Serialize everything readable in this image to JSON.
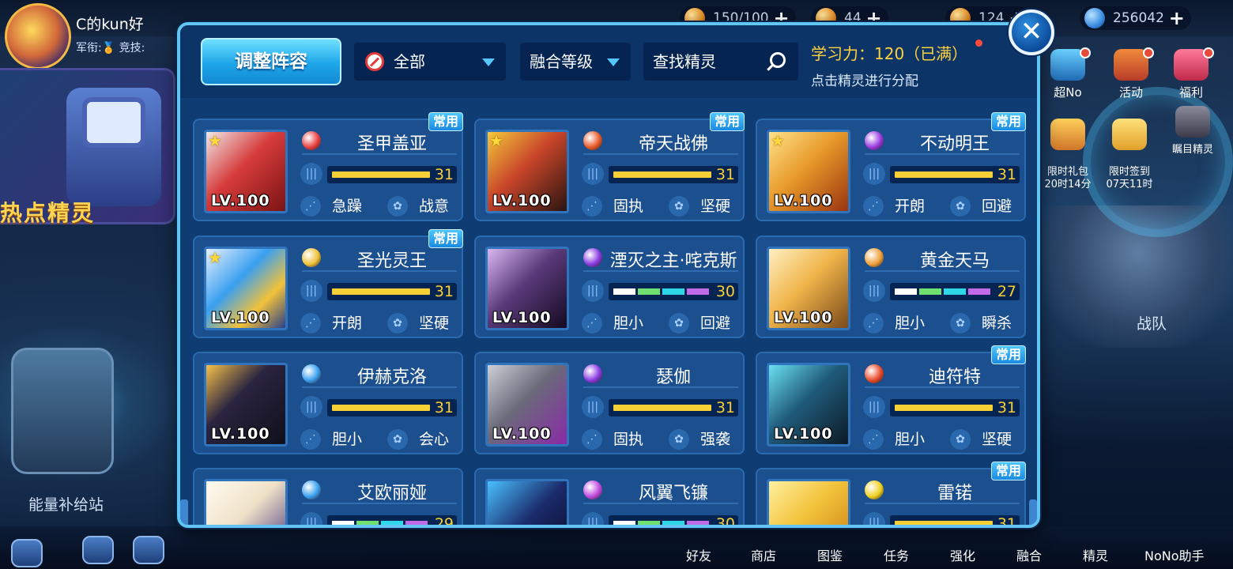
{
  "player": {
    "name": "C的kun好",
    "sub": "军衔:🏅 竞技:"
  },
  "resources": [
    {
      "value": "150/100",
      "icon": "stamina-icon"
    },
    {
      "value": "44",
      "icon": "gold-bag-icon"
    },
    {
      "value": "124",
      "icon": "coin-icon"
    },
    {
      "value": "256042",
      "icon": "planet-coin-icon"
    }
  ],
  "left_panel": {
    "hot_label": "热点精灵",
    "energy_label": "能量补给站"
  },
  "right_menu": [
    {
      "label": "超No",
      "icon": "nono-icon"
    },
    {
      "label": "活动",
      "icon": "activity-icon"
    },
    {
      "label": "福利",
      "icon": "gift-icon"
    },
    {
      "label": "限时礼包\n20时14分",
      "icon": "limited-pack-icon"
    },
    {
      "label": "限时签到\n07天11时",
      "icon": "sign-in-icon"
    },
    {
      "label": "瞩目精灵",
      "icon": "featured-spirit-icon"
    }
  ],
  "battle_label": "战队",
  "bottom_nav": [
    "好友",
    "商店",
    "图鉴",
    "任务",
    "强化",
    "融合",
    "精灵",
    "NoNo助手"
  ],
  "modal": {
    "adjust_button": "调整阵容",
    "filter_all": "全部",
    "filter_level": "融合等级",
    "search_placeholder": "查找精灵",
    "learn_power": "学习力：120（已满）",
    "learn_hint": "点击精灵进行分配",
    "close": "✕"
  },
  "cards": [
    {
      "name": "圣甲盖亚",
      "level": "LV.100",
      "tag": "常用",
      "star": true,
      "attr_color": "#e84040",
      "bar": "full",
      "value": "31",
      "traits": [
        "急躁",
        "战意"
      ],
      "palette": "p-red"
    },
    {
      "name": "帝天战佛",
      "level": "LV.100",
      "tag": "常用",
      "star": true,
      "attr_color": "#e85a2a",
      "bar": "full",
      "value": "31",
      "traits": [
        "固执",
        "坚硬"
      ],
      "palette": "p-dark"
    },
    {
      "name": "不动明王",
      "level": "LV.100",
      "tag": "常用",
      "star": true,
      "attr_color": "#9a3ae0",
      "bar": "full",
      "value": "31",
      "traits": [
        "开朗",
        "回避"
      ],
      "palette": "p-gold"
    },
    {
      "name": "圣光灵王",
      "level": "LV.100",
      "tag": "常用",
      "star": true,
      "attr_color": "#f0c23a",
      "bar": "full",
      "value": "31",
      "traits": [
        "开朗",
        "坚硬"
      ],
      "palette": "p-blue"
    },
    {
      "name": "湮灭之主·咤克斯",
      "level": "LV.100",
      "tag": "",
      "star": false,
      "attr_color": "#8a3ae0",
      "bar": "seg",
      "value": "30",
      "traits": [
        "胆小",
        "回避"
      ],
      "palette": "p-shadow"
    },
    {
      "name": "黄金天马",
      "level": "LV.100",
      "tag": "",
      "star": false,
      "attr_color": "#f0a03a",
      "bar": "seg",
      "value": "27",
      "traits": [
        "胆小",
        "瞬杀"
      ],
      "palette": "p-horse"
    },
    {
      "name": "伊赫克洛",
      "level": "LV.100",
      "tag": "",
      "star": false,
      "attr_color": "#3aa0f0",
      "bar": "full",
      "value": "31",
      "traits": [
        "胆小",
        "会心"
      ],
      "palette": "p-black"
    },
    {
      "name": "瑟伽",
      "level": "LV.100",
      "tag": "",
      "star": false,
      "attr_color": "#8a3ae0",
      "bar": "full",
      "value": "31",
      "traits": [
        "固执",
        "强袭"
      ],
      "palette": "p-gray"
    },
    {
      "name": "迪符特",
      "level": "LV.100",
      "tag": "常用",
      "star": false,
      "attr_color": "#e84a2a",
      "bar": "full",
      "value": "31",
      "traits": [
        "胆小",
        "坚硬"
      ],
      "palette": "p-teal"
    },
    {
      "name": "艾欧丽娅",
      "level": "",
      "tag": "",
      "star": false,
      "attr_color": "#3aa0f0",
      "bar": "seg",
      "value": "29",
      "traits": [],
      "palette": "p-pale"
    },
    {
      "name": "风翼飞镰",
      "level": "",
      "tag": "",
      "star": false,
      "attr_color": "#c04ae0",
      "bar": "seg",
      "value": "30",
      "traits": [],
      "palette": "p-cyan"
    },
    {
      "name": "雷锘",
      "level": "",
      "tag": "常用",
      "star": false,
      "attr_color": "#f0d020",
      "bar": "full",
      "value": "31",
      "traits": [],
      "palette": "p-yellow"
    }
  ]
}
